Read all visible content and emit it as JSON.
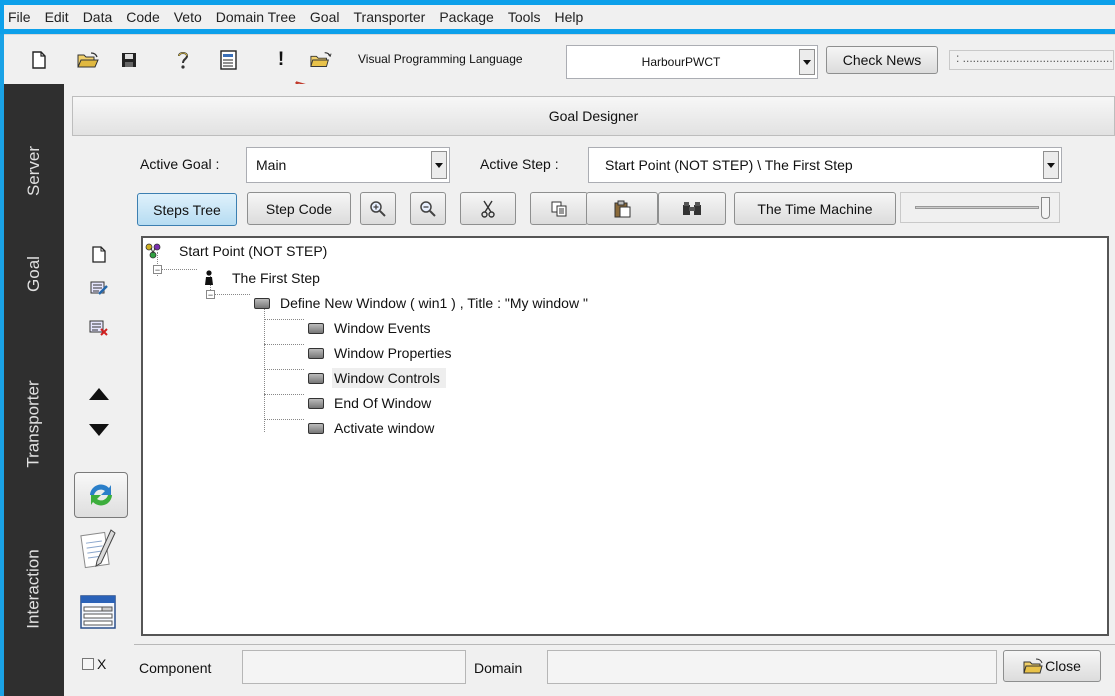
{
  "menu": [
    "File",
    "Edit",
    "Data",
    "Code",
    "Veto",
    "Domain Tree",
    "Goal",
    "Transporter",
    "Package",
    "Tools",
    "Help"
  ],
  "toolbar": {
    "icons": [
      "new-file-icon",
      "open-folder-icon",
      "save-icon",
      "help-icon",
      "document-icon",
      "exclamation-icon",
      "open-folder-arrow-icon"
    ],
    "exclamation": "!",
    "vpl_label": "Visual Programming Language",
    "vpl_value": "HarbourPWCT",
    "check_news": "Check News",
    "status_text": ": ................................................................"
  },
  "sidebar": {
    "tabs": [
      "Server",
      "Goal",
      "Transporter",
      "Interaction"
    ]
  },
  "goal_designer": {
    "title": "Goal Designer",
    "active_goal_label": "Active Goal :",
    "active_goal_value": "Main",
    "active_step_label": "Active Step :",
    "active_step_value": "Start Point (NOT STEP) \\ The First Step",
    "buttons": {
      "steps_tree": "Steps Tree",
      "step_code": "Step Code",
      "time_machine": "The Time Machine"
    },
    "tool_icons": [
      "zoom-in-icon",
      "zoom-out-icon",
      "cut-icon",
      "copy-icon",
      "paste-icon",
      "find-icon"
    ]
  },
  "tree": {
    "root": "Start Point (NOT STEP)",
    "step": "The First Step",
    "window": "Define New Window  ( win1 ) , Title : \"My window  \"",
    "children": [
      "Window Events",
      "Window Properties",
      "Window Controls",
      "End Of Window",
      "Activate window"
    ],
    "selected_child": "Window Controls"
  },
  "bottom": {
    "component_label": "Component",
    "domain_label": "Domain",
    "checkbox_label": "X",
    "close": "Close"
  },
  "colors": {
    "accent": "#1aa2e6",
    "sidebar": "#2f2f2f",
    "panel": "#f0f0f0"
  }
}
